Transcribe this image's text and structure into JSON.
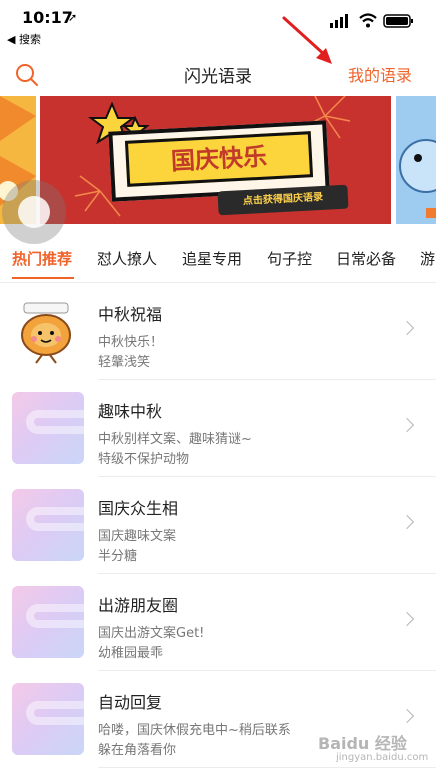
{
  "status": {
    "time": "10:17",
    "back_label": "◀ 搜索"
  },
  "nav": {
    "title": "闪光语录",
    "mine_label": "我的语录"
  },
  "banner": {
    "title": "国庆快乐",
    "button_label": "点击获得国庆语录"
  },
  "tabs": [
    {
      "label": "热门推荐",
      "active": true
    },
    {
      "label": "怼人撩人"
    },
    {
      "label": "追星专用"
    },
    {
      "label": "句子控"
    },
    {
      "label": "日常必备"
    },
    {
      "label": "游"
    }
  ],
  "items": [
    {
      "title": "中秋祝福",
      "subtitle": "中秋快乐！",
      "author": "轻鞶浅笑",
      "thumb": "mooncake-character-icon"
    },
    {
      "title": "趣味中秋",
      "subtitle": "中秋别样文案、趣味猜谜~",
      "author": "特级不保护动物",
      "thumb": "placeholder-gradient"
    },
    {
      "title": "国庆众生相",
      "subtitle": "国庆趣味文案",
      "author": "半分糖",
      "thumb": "placeholder-gradient"
    },
    {
      "title": "出游朋友圈",
      "subtitle": "国庆出游文案Get!",
      "author": "幼稚园最乖",
      "thumb": "placeholder-gradient"
    },
    {
      "title": "自动回复",
      "subtitle": "哈喽，国庆休假充电中~稍后联系",
      "author": "躲在角落看你",
      "thumb": "placeholder-gradient"
    }
  ],
  "watermark": {
    "text": "Baidu 经验",
    "sub": "jingyan.baidu.com"
  },
  "colors": {
    "accent": "#f0642c",
    "annotation": "#e02020"
  }
}
